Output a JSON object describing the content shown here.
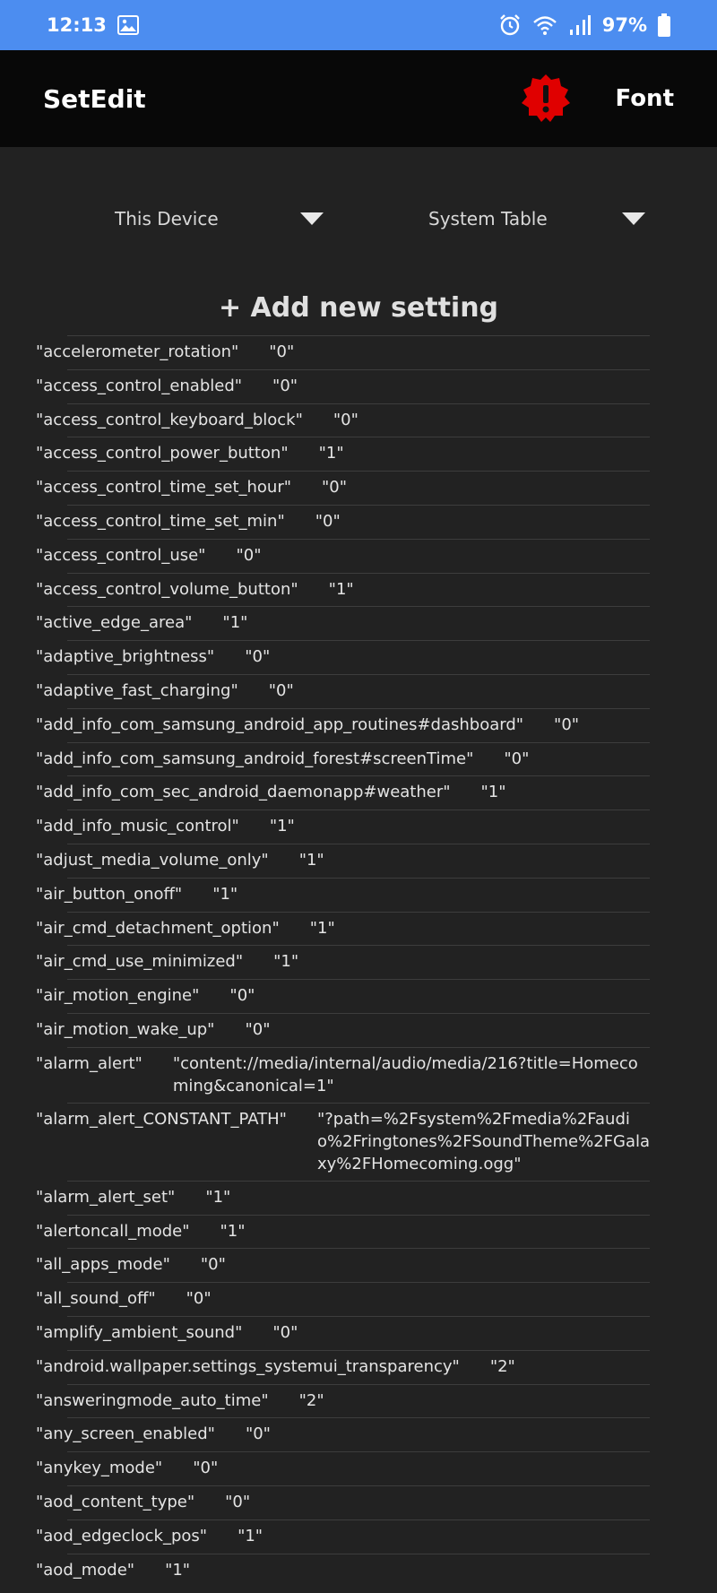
{
  "status_bar": {
    "time": "12:13",
    "battery": "97%"
  },
  "app_bar": {
    "title": "SetEdit",
    "font_label": "Font"
  },
  "selectors": {
    "device": "This Device",
    "table": "System Table"
  },
  "add_setting_label": "+ Add new setting",
  "settings": [
    {
      "key": "\"accelerometer_rotation\"",
      "value": "\"0\""
    },
    {
      "key": "\"access_control_enabled\"",
      "value": "\"0\""
    },
    {
      "key": "\"access_control_keyboard_block\"",
      "value": "\"0\""
    },
    {
      "key": "\"access_control_power_button\"",
      "value": "\"1\""
    },
    {
      "key": "\"access_control_time_set_hour\"",
      "value": "\"0\""
    },
    {
      "key": "\"access_control_time_set_min\"",
      "value": "\"0\""
    },
    {
      "key": "\"access_control_use\"",
      "value": "\"0\""
    },
    {
      "key": "\"access_control_volume_button\"",
      "value": "\"1\""
    },
    {
      "key": "\"active_edge_area\"",
      "value": "\"1\""
    },
    {
      "key": "\"adaptive_brightness\"",
      "value": "\"0\""
    },
    {
      "key": "\"adaptive_fast_charging\"",
      "value": "\"0\""
    },
    {
      "key": "\"add_info_com_samsung_android_app_routines#dashboard\"",
      "value": "\"0\""
    },
    {
      "key": "\"add_info_com_samsung_android_forest#screenTime\"",
      "value": "\"0\""
    },
    {
      "key": "\"add_info_com_sec_android_daemonapp#weather\"",
      "value": "\"1\""
    },
    {
      "key": "\"add_info_music_control\"",
      "value": "\"1\""
    },
    {
      "key": "\"adjust_media_volume_only\"",
      "value": "\"1\""
    },
    {
      "key": "\"air_button_onoff\"",
      "value": "\"1\""
    },
    {
      "key": "\"air_cmd_detachment_option\"",
      "value": "\"1\""
    },
    {
      "key": "\"air_cmd_use_minimized\"",
      "value": "\"1\""
    },
    {
      "key": "\"air_motion_engine\"",
      "value": "\"0\""
    },
    {
      "key": "\"air_motion_wake_up\"",
      "value": "\"0\""
    },
    {
      "key": "\"alarm_alert\"",
      "value": "\"content://media/internal/audio/media/216?title=Homecoming&canonical=1\""
    },
    {
      "key": "\"alarm_alert_CONSTANT_PATH\"",
      "value": "\"?path=%2Fsystem%2Fmedia%2Faudio%2Fringtones%2FSoundTheme%2FGalaxy%2FHomecoming.ogg\""
    },
    {
      "key": "\"alarm_alert_set\"",
      "value": "\"1\""
    },
    {
      "key": "\"alertoncall_mode\"",
      "value": "\"1\""
    },
    {
      "key": "\"all_apps_mode\"",
      "value": "\"0\""
    },
    {
      "key": "\"all_sound_off\"",
      "value": "\"0\""
    },
    {
      "key": "\"amplify_ambient_sound\"",
      "value": "\"0\""
    },
    {
      "key": "\"android.wallpaper.settings_systemui_transparency\"",
      "value": "\"2\""
    },
    {
      "key": "\"answeringmode_auto_time\"",
      "value": "\"2\""
    },
    {
      "key": "\"any_screen_enabled\"",
      "value": "\"0\""
    },
    {
      "key": "\"anykey_mode\"",
      "value": "\"0\""
    },
    {
      "key": "\"aod_content_type\"",
      "value": "\"0\""
    },
    {
      "key": "\"aod_edgeclock_pos\"",
      "value": "\"1\""
    },
    {
      "key": "\"aod_mode\"",
      "value": "\"1\""
    }
  ]
}
